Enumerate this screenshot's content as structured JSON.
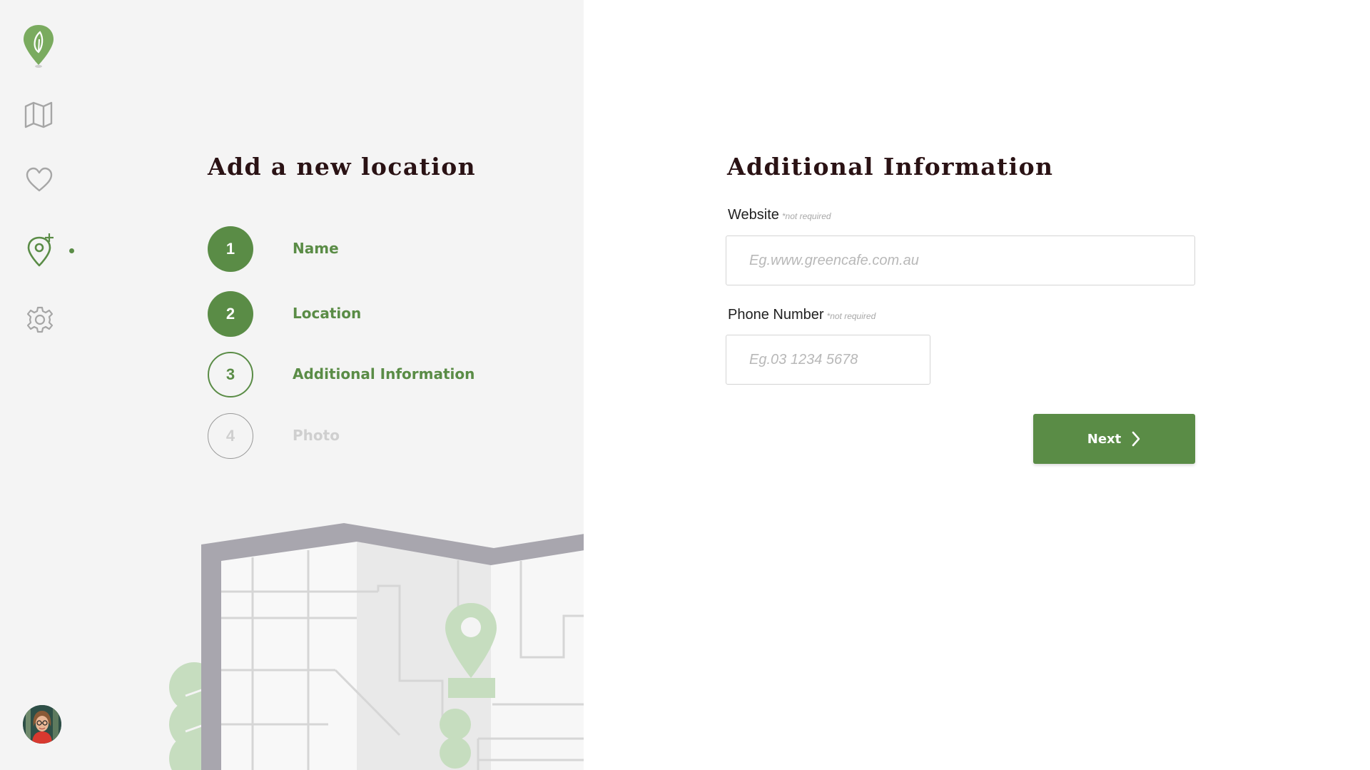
{
  "sidebar": {
    "items": [
      {
        "name": "logo",
        "icon": "leaf-pin-icon"
      },
      {
        "name": "map",
        "icon": "map-icon"
      },
      {
        "name": "favourites",
        "icon": "heart-icon"
      },
      {
        "name": "add-location",
        "icon": "add-location-icon",
        "active": true
      },
      {
        "name": "settings",
        "icon": "gear-icon"
      }
    ],
    "avatar": "user-avatar"
  },
  "wizard": {
    "title": "Add a new location",
    "steps": [
      {
        "number": "1",
        "label": "Name",
        "state": "done"
      },
      {
        "number": "2",
        "label": "Location",
        "state": "done"
      },
      {
        "number": "3",
        "label": "Additional Information",
        "state": "current"
      },
      {
        "number": "4",
        "label": "Photo",
        "state": "pending"
      }
    ]
  },
  "form": {
    "title": "Additional Information",
    "website": {
      "label": "Website",
      "hint": "*not required",
      "placeholder": "Eg.www.greencafe.com.au",
      "value": ""
    },
    "phone": {
      "label": "Phone Number",
      "hint": "*not required",
      "placeholder": "Eg.03 1234 5678",
      "value": ""
    },
    "next_label": "Next"
  },
  "colors": {
    "accent": "#5a8c46",
    "title": "#2a1214",
    "left_panel_bg": "#f4f4f4",
    "pending": "#cfcfcf"
  }
}
